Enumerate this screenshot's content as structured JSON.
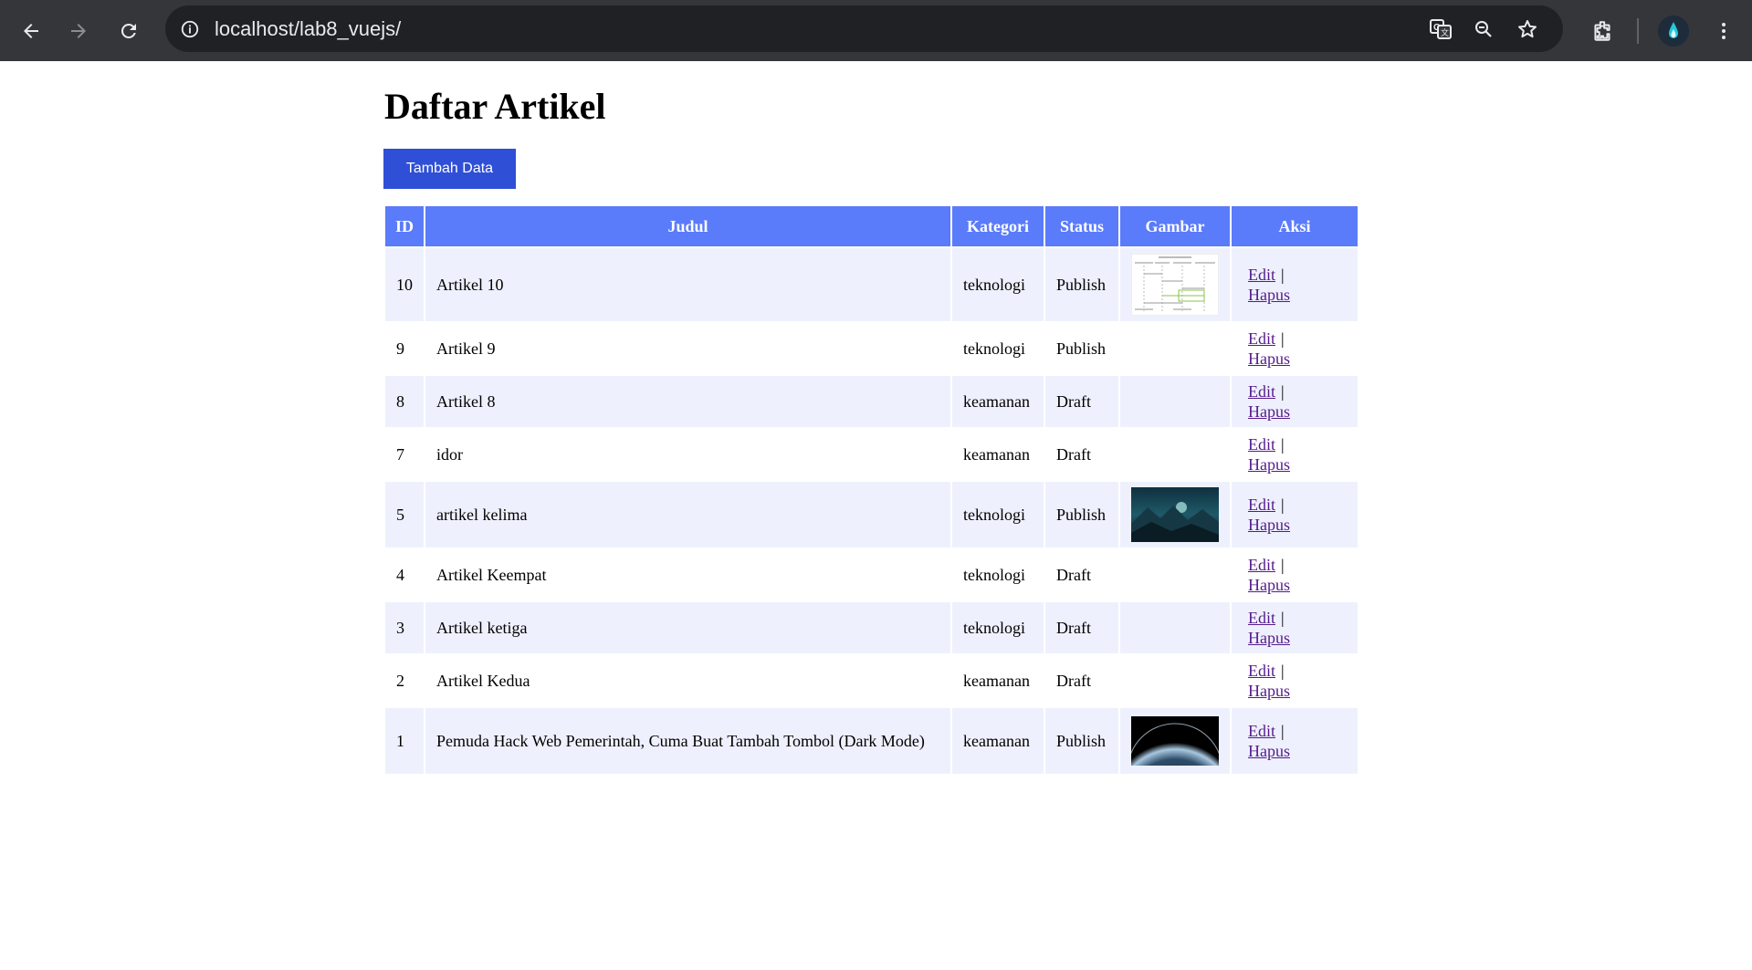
{
  "browser": {
    "url": "localhost/lab8_vuejs/"
  },
  "page": {
    "title": "Daftar Artikel",
    "add_button": "Tambah Data"
  },
  "table": {
    "headers": [
      "ID",
      "Judul",
      "Kategori",
      "Status",
      "Gambar",
      "Aksi"
    ],
    "edit_label": "Edit",
    "separator": "|",
    "delete_label": "Hapus",
    "rows": [
      {
        "id": "10",
        "judul": "Artikel 10",
        "kategori": "teknologi",
        "status": "Publish",
        "gambar": "diagram-thumbnail"
      },
      {
        "id": "9",
        "judul": "Artikel 9",
        "kategori": "teknologi",
        "status": "Publish",
        "gambar": ""
      },
      {
        "id": "8",
        "judul": "Artikel 8",
        "kategori": "keamanan",
        "status": "Draft",
        "gambar": ""
      },
      {
        "id": "7",
        "judul": "idor",
        "kategori": "keamanan",
        "status": "Draft",
        "gambar": ""
      },
      {
        "id": "5",
        "judul": "artikel kelima",
        "kategori": "teknologi",
        "status": "Publish",
        "gambar": "landscape-thumbnail"
      },
      {
        "id": "4",
        "judul": "Artikel Keempat",
        "kategori": "teknologi",
        "status": "Draft",
        "gambar": ""
      },
      {
        "id": "3",
        "judul": "Artikel ketiga",
        "kategori": "teknologi",
        "status": "Draft",
        "gambar": ""
      },
      {
        "id": "2",
        "judul": "Artikel Kedua",
        "kategori": "keamanan",
        "status": "Draft",
        "gambar": ""
      },
      {
        "id": "1",
        "judul": "Pemuda Hack Web Pemerintah, Cuma Buat Tambah Tombol (Dark Mode)",
        "kategori": "keamanan",
        "status": "Publish",
        "gambar": "planet-thumbnail"
      }
    ]
  },
  "icons": [
    "back-icon",
    "forward-icon",
    "reload-icon",
    "info-icon",
    "translate-icon",
    "zoom-icon",
    "star-icon",
    "extensions-icon",
    "profile-avatar",
    "menu-icon"
  ],
  "colors": {
    "chrome_bg": "#35363a",
    "omnibox_bg": "#202124",
    "button_bg": "#2f4fd6",
    "header_bg": "#5a7bfa",
    "row_alt_bg": "#eef1fd",
    "link": "#551a8b"
  }
}
